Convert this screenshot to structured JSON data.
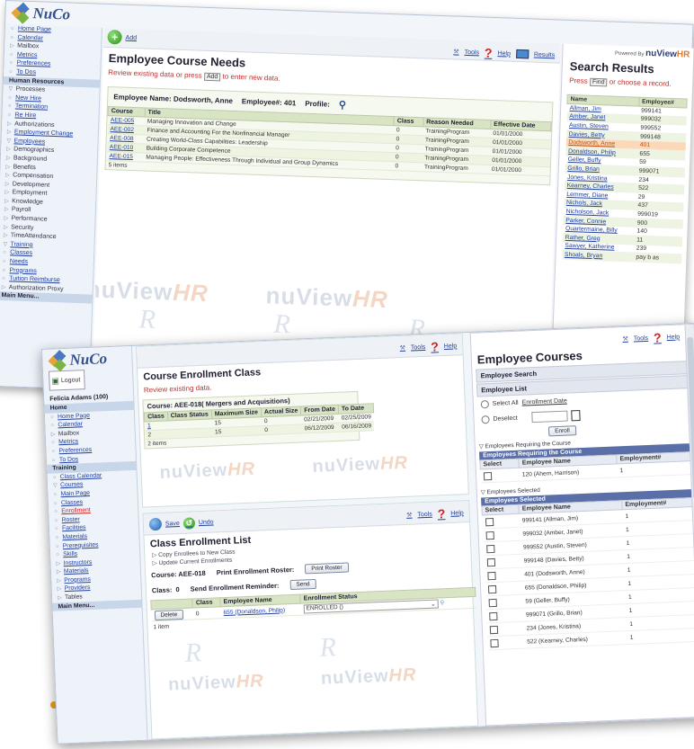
{
  "back": {
    "brand": "NuCo",
    "sidebar": [
      {
        "label": "Home Page",
        "cls": "link",
        "ic": "○"
      },
      {
        "label": "Calendar",
        "cls": "link",
        "ic": "○"
      },
      {
        "label": "Mailbox",
        "cls": "",
        "ic": "▷"
      },
      {
        "label": "Metrics",
        "cls": "link",
        "ic": "○"
      },
      {
        "label": "Preferences",
        "cls": "link",
        "ic": "○"
      },
      {
        "label": "To Dos",
        "cls": "link",
        "ic": "○"
      },
      {
        "label": "Human Resources",
        "cls": "head",
        "ic": ""
      },
      {
        "label": "Processes",
        "cls": "",
        "ic": "▽"
      },
      {
        "label": "New Hire",
        "cls": "link",
        "ic": "○"
      },
      {
        "label": "Termination",
        "cls": "link",
        "ic": "○"
      },
      {
        "label": "Re Hire",
        "cls": "link",
        "ic": "○"
      },
      {
        "label": "Authorizations",
        "cls": "",
        "ic": "▷"
      },
      {
        "label": "Employment Change",
        "cls": "link",
        "ic": "▷"
      },
      {
        "label": "Employees",
        "cls": "link",
        "ic": "▽"
      },
      {
        "label": "Demographics",
        "cls": "",
        "ic": "▷"
      },
      {
        "label": "Background",
        "cls": "",
        "ic": "▷"
      },
      {
        "label": "Benefits",
        "cls": "",
        "ic": "▷"
      },
      {
        "label": "Compensation",
        "cls": "",
        "ic": "▷"
      },
      {
        "label": "Development",
        "cls": "",
        "ic": "▷"
      },
      {
        "label": "Employment",
        "cls": "",
        "ic": "▷"
      },
      {
        "label": "Knowledge",
        "cls": "",
        "ic": "▷"
      },
      {
        "label": "Payroll",
        "cls": "",
        "ic": "▷"
      },
      {
        "label": "Performance",
        "cls": "",
        "ic": "▷"
      },
      {
        "label": "Security",
        "cls": "",
        "ic": "▷"
      },
      {
        "label": "TimeAttendance",
        "cls": "",
        "ic": "▷"
      },
      {
        "label": "Training",
        "cls": "link",
        "ic": "▽"
      },
      {
        "label": "Classes",
        "cls": "link",
        "ic": "○"
      },
      {
        "label": "Needs",
        "cls": "link",
        "ic": "○"
      },
      {
        "label": "Programs",
        "cls": "link",
        "ic": "○"
      },
      {
        "label": "Tuition Reimburse",
        "cls": "link",
        "ic": "○"
      },
      {
        "label": "Authorization Proxy",
        "cls": "",
        "ic": "▷"
      },
      {
        "label": "Main Menu...",
        "cls": "head",
        "ic": ""
      }
    ],
    "toolbar": {
      "add": "Add",
      "tools": "Tools",
      "help": "Help",
      "results": "Results"
    },
    "title": "Employee Course Needs",
    "subtitle_pre": "Review existing data or press",
    "subtitle_btn": "Add",
    "subtitle_post": "to enter new data.",
    "employee_line": {
      "name_label": "Employee Name:",
      "name": "Dodsworth, Anne",
      "num_label": "Employee#:",
      "num": "401",
      "profile": "Profile:"
    },
    "columns": [
      "Course",
      "Title",
      "Class",
      "Reason Needed",
      "Effective Date"
    ],
    "rows": [
      [
        "AEE-005",
        "Managing Innovation and Change",
        "0",
        "TrainingProgram",
        "01/01/2000"
      ],
      [
        "AEE-002",
        "Finance and Accounting For the Nonfinancial Manager",
        "0",
        "TrainingProgram",
        "01/01/2000"
      ],
      [
        "AEE-008",
        "Creating World-Class Capabilities: Leadership",
        "0",
        "TrainingProgram",
        "01/01/2000"
      ],
      [
        "AEE-010",
        "Building Corporate Competence",
        "0",
        "TrainingProgram",
        "01/01/2000"
      ],
      [
        "AEE-015",
        "Managing People: Effectiveness Through Individual and Group Dynamics",
        "0",
        "TrainingProgram",
        "01/01/2000"
      ]
    ],
    "items_count": "5 items",
    "watermark": {
      "a": "nuView",
      "b": "HR"
    },
    "search": {
      "powered_by": "Powered By",
      "powered_logo": "nuView",
      "powered_hr": "HR",
      "title": "Search Results",
      "sub_pre": "Press",
      "sub_btn": "Find",
      "sub_post": "or choose a record.",
      "columns": [
        "Name",
        "Employee#"
      ],
      "rows": [
        [
          "Allman, Jim",
          "999141"
        ],
        [
          "Amber, Janet",
          "999032"
        ],
        [
          "Austin, Steven",
          "999552"
        ],
        [
          "Davies, Betty",
          "999148"
        ],
        [
          "Dodsworth, Anne",
          "401"
        ],
        [
          "Donaldson, Philip",
          "655"
        ],
        [
          "Geller, Buffy",
          "59"
        ],
        [
          "Grillo, Brian",
          "999071"
        ],
        [
          "Jones, Kristina",
          "234"
        ],
        [
          "Kearney, Charles",
          "522"
        ],
        [
          "Lemmer, Diane",
          "29"
        ],
        [
          "Nichols, Jack",
          "437"
        ],
        [
          "Nicholson, Jack",
          "999019"
        ],
        [
          "Parker, Connie",
          "900"
        ],
        [
          "Quartermaine, Billy",
          "140"
        ],
        [
          "Rather, Greg",
          "11"
        ],
        [
          "Sawyer, Katherine",
          "239"
        ],
        [
          "Shoals, Bryan",
          "pay b as"
        ]
      ]
    }
  },
  "front": {
    "brand": "NuCo",
    "logout": "Logout",
    "user": "Felicia Adams (100)",
    "sidebar": [
      {
        "label": "Home",
        "cls": "head",
        "ic": ""
      },
      {
        "label": "Home Page",
        "cls": "link",
        "ic": "○"
      },
      {
        "label": "Calendar",
        "cls": "link",
        "ic": "○"
      },
      {
        "label": "Mailbox",
        "cls": "",
        "ic": "▷"
      },
      {
        "label": "Metrics",
        "cls": "link",
        "ic": "○"
      },
      {
        "label": "Preferences",
        "cls": "link",
        "ic": "○"
      },
      {
        "label": "To Dos",
        "cls": "link",
        "ic": "○"
      },
      {
        "label": "Training",
        "cls": "head",
        "ic": ""
      },
      {
        "label": "Class Calendar",
        "cls": "link",
        "ic": "○"
      },
      {
        "label": "Courses",
        "cls": "link",
        "ic": "▽"
      },
      {
        "label": "Main Page",
        "cls": "link",
        "ic": "○"
      },
      {
        "label": "Classes",
        "cls": "link",
        "ic": "○"
      },
      {
        "label": "Enrollment",
        "cls": "link active",
        "ic": "○"
      },
      {
        "label": "Roster",
        "cls": "link",
        "ic": "○"
      },
      {
        "label": "Facilities",
        "cls": "link",
        "ic": "○"
      },
      {
        "label": "Materials",
        "cls": "link",
        "ic": "○"
      },
      {
        "label": "Prerequisites",
        "cls": "link",
        "ic": "○"
      },
      {
        "label": "Skills",
        "cls": "link",
        "ic": "○"
      },
      {
        "label": "Instructors",
        "cls": "link",
        "ic": "▷"
      },
      {
        "label": "Materials",
        "cls": "link",
        "ic": "▷"
      },
      {
        "label": "Programs",
        "cls": "link",
        "ic": "▷"
      },
      {
        "label": "Providers",
        "cls": "link",
        "ic": "▷"
      },
      {
        "label": "Tables",
        "cls": "",
        "ic": "▷"
      },
      {
        "label": "Main Menu...",
        "cls": "head",
        "ic": ""
      }
    ],
    "class_panel": {
      "tools": "Tools",
      "help": "Help",
      "title": "Course Enrollment Class",
      "subtitle": "Review existing data.",
      "course_caption": "Course: AEE-018( Mergers and Acquisitions)",
      "columns": [
        "Class",
        "Class Status",
        "Maximum Size",
        "Actual Size",
        "From Date",
        "To Date"
      ],
      "rows": [
        [
          "1",
          "",
          "15",
          "0",
          "02/21/2009",
          "02/25/2009"
        ],
        [
          "2",
          "",
          "15",
          "0",
          "06/12/2009",
          "06/16/2009"
        ]
      ],
      "items_count": "2 items"
    },
    "list_panel": {
      "save": "Save",
      "undo": "Undo",
      "tools": "Tools",
      "help": "Help",
      "title": "Class Enrollment List",
      "opt1": "Copy Enrollees to New Class",
      "opt2": "Update Current Enrollments",
      "course": "Course: AEE-018",
      "print_label": "Print Enrollment Roster:",
      "print_btn": "Print Roster",
      "class_label": "Class:",
      "class_value": "0",
      "send_label": "Send Enrollment Reminder:",
      "send_btn": "Send",
      "columns": [
        "",
        "Class",
        "Employee Name",
        "Enrollment Status"
      ],
      "row": {
        "btn": "Delete",
        "class": "0",
        "name": "655 (Donaldson, Philip)",
        "status": "ENROLLED ()"
      },
      "items_count": "1 item"
    },
    "courses_panel": {
      "tools": "Tools",
      "help": "Help",
      "title": "Employee Courses",
      "search_strip": "Employee Search",
      "list_strip": "Employee List",
      "select_all": "Select All",
      "deselect": "Deselect",
      "enroll_date": "Enrollment Date",
      "enroll_btn": "Enroll",
      "req_head": "Employees Requiring the Course",
      "req_bar": "Employees Requiring the Course",
      "columns": [
        "Select",
        "Employee Name",
        "Employment#"
      ],
      "req_rows": [
        [
          "120 (Ahern, Harrison)",
          "1"
        ]
      ],
      "sel_head": "Employees Selected",
      "sel_bar": "Employees Selected",
      "sel_rows": [
        [
          "999141 (Allman, Jim)",
          "1"
        ],
        [
          "999032 (Amber, Janet)",
          "1"
        ],
        [
          "999552 (Austin, Steven)",
          "1"
        ],
        [
          "999148 (Davies, Betty)",
          "1"
        ],
        [
          "401 (Dodsworth, Anne)",
          "1"
        ],
        [
          "655 (Donaldson, Philip)",
          "1"
        ],
        [
          "59 (Geller, Buffy)",
          "1"
        ],
        [
          "999071 (Grillo, Brian)",
          "1"
        ],
        [
          "234 (Jones, Kristina)",
          "1"
        ],
        [
          "522 (Kearney, Charles)",
          "1"
        ]
      ]
    }
  }
}
